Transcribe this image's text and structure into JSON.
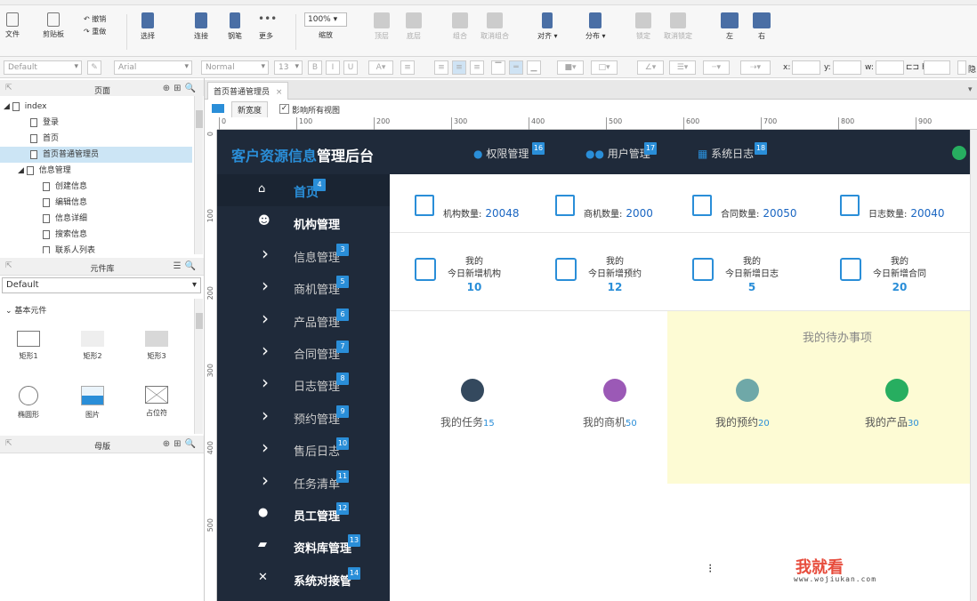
{
  "ribbon": {
    "file": "文件",
    "clipboard": "剪贴板",
    "undo": "撤销",
    "redo": "重做",
    "select": "选择",
    "connect": "连接",
    "pen": "钢笔",
    "more": "更多",
    "zoom_value": "100%",
    "zoom": "缩放",
    "top": "顶层",
    "bottom": "底层",
    "group": "组合",
    "ungroup": "取消组合",
    "align": "对齐",
    "distribute": "分布",
    "lock": "锁定",
    "unlock": "取消锁定",
    "left": "左",
    "right": "右"
  },
  "format": {
    "style": "Default",
    "font": "Arial",
    "weight": "Normal",
    "size": "13",
    "x_label": "x:",
    "y_label": "y:",
    "w_label": "w:",
    "h_label": "h:",
    "hidden": "隐"
  },
  "pages_panel": {
    "title": "页面",
    "items": [
      {
        "label": "index"
      },
      {
        "label": "登录"
      },
      {
        "label": "首页"
      },
      {
        "label": "首页普通管理员"
      },
      {
        "label": "信息管理"
      },
      {
        "label": "创建信息"
      },
      {
        "label": "编辑信息"
      },
      {
        "label": "信息详细"
      },
      {
        "label": "搜索信息"
      },
      {
        "label": "联系人列表"
      }
    ]
  },
  "widgets_panel": {
    "title": "元件库",
    "library": "Default",
    "group": "基本元件",
    "items": [
      {
        "label": "矩形1"
      },
      {
        "label": "矩形2"
      },
      {
        "label": "矩形3"
      },
      {
        "label": "椭圆形"
      },
      {
        "label": "图片"
      },
      {
        "label": "占位符"
      }
    ]
  },
  "masters_panel": {
    "title": "母版"
  },
  "canvas": {
    "tab": "首页普通管理员",
    "adaptive": "新宽度",
    "affect_all": "影响所有视图",
    "ruler_h": [
      "0",
      "100",
      "200",
      "300",
      "400",
      "500",
      "600",
      "700",
      "800",
      "900"
    ],
    "ruler_v": [
      "0",
      "100",
      "200",
      "300",
      "400",
      "500"
    ]
  },
  "mock": {
    "title_accent": "客户资源信息",
    "title_rest": "管理后台",
    "top_nav": [
      {
        "label": "权限管理",
        "badge": "16"
      },
      {
        "label": "用户管理",
        "badge": "17"
      },
      {
        "label": "系统日志",
        "badge": "18"
      }
    ],
    "sidebar": [
      {
        "label": "首页",
        "badge": "4",
        "icon": "home-icon"
      },
      {
        "label": "机构管理",
        "badge": "",
        "icon": "group-icon"
      },
      {
        "label": "信息管理",
        "badge": "3",
        "icon": "chevron-right-icon"
      },
      {
        "label": "商机管理",
        "badge": "5",
        "icon": "chevron-right-icon"
      },
      {
        "label": "产品管理",
        "badge": "6",
        "icon": "chevron-right-icon"
      },
      {
        "label": "合同管理",
        "badge": "7",
        "icon": "chevron-right-icon"
      },
      {
        "label": "日志管理",
        "badge": "8",
        "icon": "chevron-right-icon"
      },
      {
        "label": "预约管理",
        "badge": "9",
        "icon": "chevron-right-icon"
      },
      {
        "label": "售后日志",
        "badge": "10",
        "icon": "chevron-right-icon"
      },
      {
        "label": "任务清单",
        "badge": "11",
        "icon": "chevron-right-icon"
      },
      {
        "label": "员工管理",
        "badge": "12",
        "icon": "user-icon"
      },
      {
        "label": "资料库管理",
        "badge": "13",
        "icon": "folder-icon"
      },
      {
        "label": "系统对接管",
        "badge": "14",
        "icon": "link-icon"
      }
    ],
    "stats": [
      {
        "label": "机构数量:",
        "value": "20048"
      },
      {
        "label": "商机数量:",
        "value": "2000"
      },
      {
        "label": "合同数量:",
        "value": "20050"
      },
      {
        "label": "日志数量:",
        "value": "20040"
      }
    ],
    "today": [
      {
        "l1": "我的",
        "l2": "今日新增机构",
        "value": "10"
      },
      {
        "l1": "我的",
        "l2": "今日新增预约",
        "value": "12"
      },
      {
        "l1": "我的",
        "l2": "今日新增日志",
        "value": "5"
      },
      {
        "l1": "我的",
        "l2": "今日新增合同",
        "value": "20"
      }
    ],
    "todo_title": "我的待办事项",
    "todos": [
      {
        "label": "我的任务",
        "count": "15",
        "color": "#34495e"
      },
      {
        "label": "我的商机",
        "count": "50",
        "color": "#9b59b6"
      },
      {
        "label": "我的预约",
        "count": "20",
        "color": "#6fa8a8"
      },
      {
        "label": "我的产品",
        "count": "30",
        "color": "#27ae60"
      }
    ],
    "watermark": "我就看",
    "watermark_url": "www.wojiukan.com"
  },
  "colors": {
    "accent": "#2a8ed8",
    "dark": "#1f2a3a",
    "todo_bg": "#fdfbd4"
  }
}
